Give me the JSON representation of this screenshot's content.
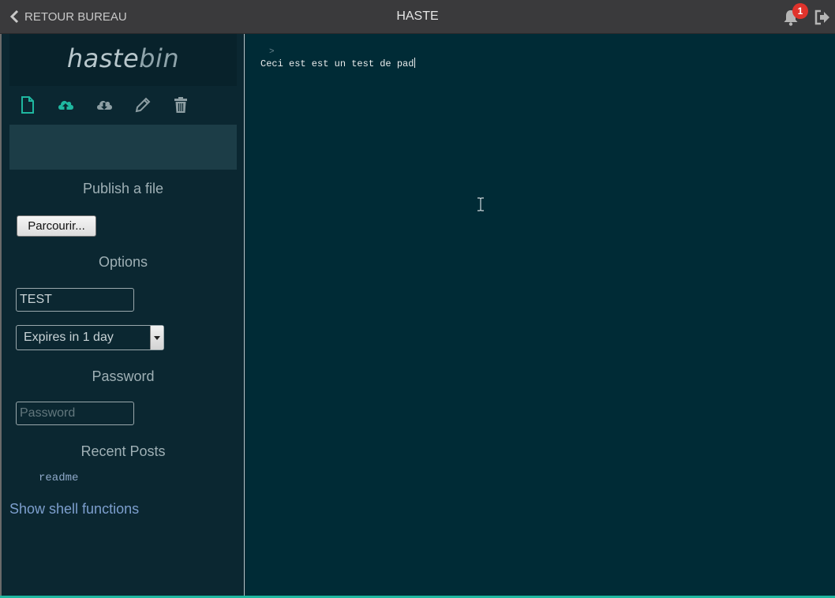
{
  "topbar": {
    "back_label": "RETOUR BUREAU",
    "title": "HASTE",
    "notification_count": "1"
  },
  "sidebar": {
    "logo_part1": "haste",
    "logo_part2": "bin",
    "toolbar_icons": [
      "new-file-icon",
      "upload-cloud-icon",
      "download-cloud-icon",
      "edit-pencil-icon",
      "trash-icon"
    ],
    "publish_title": "Publish a file",
    "browse_label": "Parcourir...",
    "options_title": "Options",
    "title_value": "TEST",
    "expiry_selected": "Expires in 1 day",
    "password_title": "Password",
    "password_placeholder": "Password",
    "recent_title": "Recent Posts",
    "recent_posts": [
      "readme"
    ],
    "shell_link": "Show shell functions"
  },
  "editor": {
    "prompt": ">",
    "content": "Ceci est est un test de pad"
  },
  "colors": {
    "accent": "#1fb7a0",
    "editor_bg": "#002b36",
    "badge": "#e0332c",
    "link": "#7d9fce"
  }
}
